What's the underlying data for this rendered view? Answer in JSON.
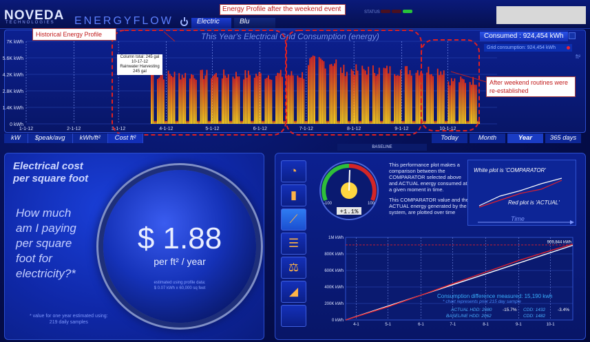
{
  "header": {
    "logo": "NOVEDA",
    "logo_sub": "TECHNOLOGIES",
    "product": "ENERGYFLOW",
    "tabs": [
      "Electric",
      "Blu"
    ],
    "status_label": "STATUS"
  },
  "annotations": {
    "weekend": "Energy Profile after the weekend event",
    "historical": "Historical Energy Profile",
    "after_weekend": "After weekend routines were re-established",
    "column_total": [
      "Column total: 245 gal",
      "10-17-12",
      "Rainwater Harvesting",
      "245 gal"
    ]
  },
  "main_chart": {
    "title": "This Year's Electrical Grid Consumption (energy)",
    "consumed": "Consumed : 924,454 kWh",
    "grid_consumption": "Grid consumption: 924,454 kWh",
    "unit_toggle": "ft²",
    "units_tabs": [
      "kW",
      "$peak/avg",
      "kWh/ft²",
      "Cost ft²"
    ],
    "period_tabs": [
      "Today",
      "Month",
      "Year",
      "365 days"
    ],
    "baseline": "BASELINE"
  },
  "chart_data": [
    {
      "type": "bar",
      "title": "This Year's Electrical Grid Consumption (energy)",
      "y_unit": "kWh",
      "ylim": [
        0,
        7000
      ],
      "y_ticks": [
        "0 kWh",
        "1.4K kWh",
        "2.8K kWh",
        "4.2K kWh",
        "5.6K kWh",
        "7K kWh"
      ],
      "x_ticks": [
        "1-1-12",
        "2-1-12",
        "3-1-12",
        "4-1-12",
        "5-1-12",
        "6-1-12",
        "7-1-12",
        "8-1-12",
        "9-1-12",
        "10-1-12"
      ],
      "segments": [
        {
          "from": "3-22-12",
          "to": "7-1-12",
          "typical_kwh": 4200
        },
        {
          "from": "7-1-12",
          "to": "7-22-12",
          "typical_kwh": 5300
        },
        {
          "from": "7-22-12",
          "to": "9-30-12",
          "typical_kwh": 4600
        },
        {
          "from": "9-30-12",
          "to": "10-22-12",
          "typical_kwh": 3700
        }
      ],
      "weekend_value_kwh": 250,
      "grid": true
    },
    {
      "type": "line",
      "title": "",
      "y_unit": "kWh",
      "ylim": [
        0,
        1000000
      ],
      "y_ticks": [
        "0 kWh",
        "200K kWh",
        "400K kWh",
        "600K kWh",
        "800K kWh",
        "1M kWh"
      ],
      "x_ticks": [
        "4-1",
        "5-1",
        "6-1",
        "7-1",
        "8-1",
        "9-1",
        "10-1"
      ],
      "series": [
        {
          "name": "COMPARATOR",
          "color": "#ffffff",
          "x": [
            "3-22",
            "10-22"
          ],
          "y": [
            0,
            904000
          ]
        },
        {
          "name": "ACTUAL",
          "color": "#e0202c",
          "x": [
            "3-22",
            "5-1",
            "6-1",
            "7-1",
            "8-1",
            "9-1",
            "10-1",
            "10-22"
          ],
          "y": [
            0,
            160000,
            300000,
            440000,
            580000,
            720000,
            840000,
            919000
          ]
        }
      ],
      "reference_lines": [
        {
          "label": "BASELINE",
          "y": 909000
        }
      ],
      "end_label": "909,844 kWh"
    }
  ],
  "cost": {
    "title_line1": "Electrical cost",
    "title_line2": "per square foot",
    "question": [
      "How much",
      "am I paying",
      "per square",
      "foot for",
      "electricity?*"
    ],
    "price": "$ 1.88",
    "price_unit": "per ft² / year",
    "estimate_line1": "estimated using profile data:",
    "estimate_line2": "$ 0.07 kWh x 60,000 sq feet",
    "footnote_line1": "* value for one year estimated using:",
    "footnote_line2": "219 daily samples"
  },
  "comparator": {
    "gauge_min": "-100",
    "gauge_max": "100",
    "gauge_value": "+1.1%",
    "text1": "This performance plot makes a comparison between the COMPARATOR selected above and ACTUAL energy consumed at a given moment in time.",
    "text2": "This COMPARATOR value and the ACTUAL energy generated by the system, are plotted over time",
    "legend_white": "White plot is 'COMPARATOR'",
    "legend_red": "Red plot is 'ACTUAL'",
    "legend_time": "Time",
    "diff": "Consumption difference measured: 15,190 kwh",
    "note": "* chart represents prior 215 day sample",
    "actual_hdd": "ACTUAL HDD: 2080",
    "actual_pct": "-15.7%",
    "actual_cdd": "CDD: 1432",
    "actual_cdd_pct": "-3.4%",
    "baseline_hdd": "BASELINE HDD: 2062",
    "baseline_cdd": "CDD: 1482"
  }
}
